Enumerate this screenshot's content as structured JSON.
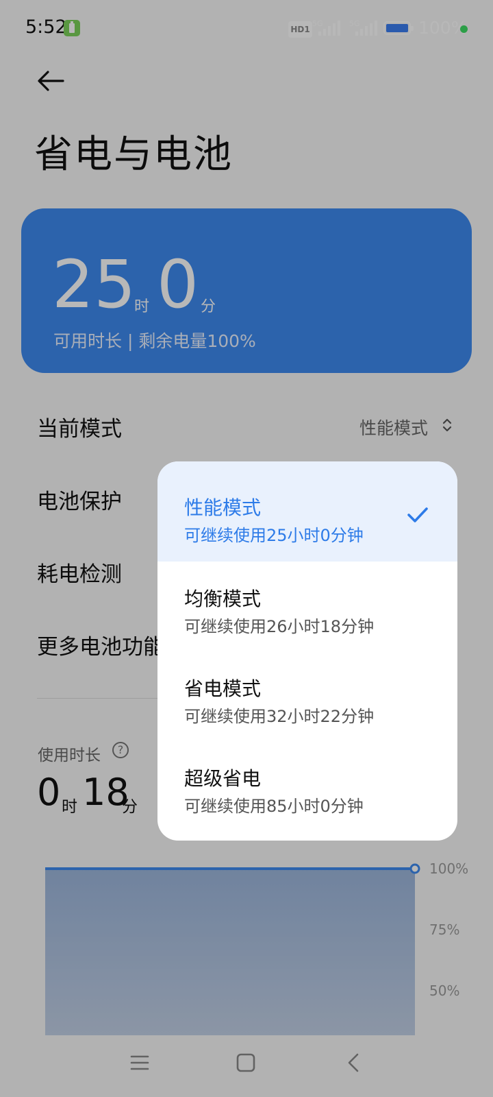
{
  "status_bar": {
    "time": "5:52",
    "hd_label": "HD1",
    "net1": "5G",
    "net2": "5G",
    "battery_percent": "100%"
  },
  "header": {
    "title": "省电与电池"
  },
  "battery_card": {
    "hours": "25",
    "hours_unit": "时",
    "minutes": "0",
    "minutes_unit": "分",
    "caption": "可用时长 | 剩余电量100%"
  },
  "settings": {
    "current_mode_label": "当前模式",
    "current_mode_value": "性能模式",
    "battery_protect_label": "电池保护",
    "consumption_check_label": "耗电检测",
    "more_features_label": "更多电池功能"
  },
  "usage": {
    "label": "使用时长",
    "help_glyph": "?",
    "hours": "0",
    "hours_unit": "时",
    "minutes": "18",
    "minutes_unit": "分"
  },
  "chart_data": {
    "type": "area",
    "ylim": [
      0,
      100
    ],
    "y_ticks": [
      "100%",
      "75%",
      "50%"
    ],
    "series": [
      {
        "values": [
          100,
          100
        ]
      }
    ]
  },
  "mode_menu": {
    "options": [
      {
        "name": "性能模式",
        "desc": "可继续使用25小时0分钟",
        "selected": true
      },
      {
        "name": "均衡模式",
        "desc": "可继续使用26小时18分钟",
        "selected": false
      },
      {
        "name": "省电模式",
        "desc": "可继续使用32小时22分钟",
        "selected": false
      },
      {
        "name": "超级省电",
        "desc": "可继续使用85小时0分钟",
        "selected": false
      }
    ]
  },
  "colors": {
    "accent": "#3d89ef",
    "selected_text": "#2d7be8",
    "selected_bg": "#e9f1fd"
  },
  "icons": {
    "back": "back-arrow-icon",
    "check": "check-icon",
    "sort": "up-down-chevron-icon",
    "nav_menu": "menu-icon",
    "nav_home": "home-icon",
    "nav_back": "back-icon"
  }
}
